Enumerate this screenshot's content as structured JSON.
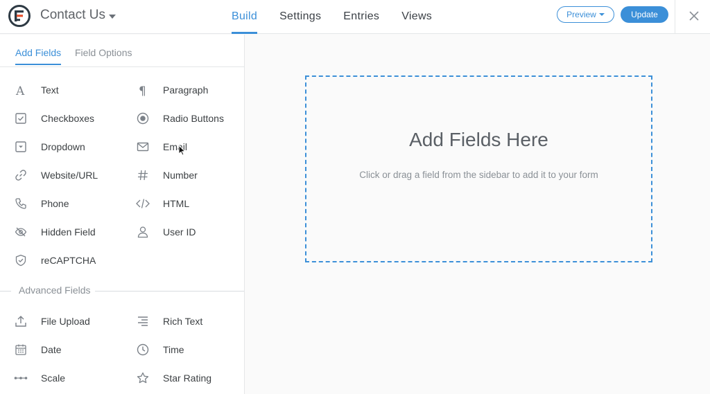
{
  "app": {
    "form_title": "Contact Us"
  },
  "nav": {
    "items": [
      {
        "label": "Build",
        "active": true
      },
      {
        "label": "Settings",
        "active": false
      },
      {
        "label": "Entries",
        "active": false
      },
      {
        "label": "Views",
        "active": false
      }
    ]
  },
  "actions": {
    "preview_label": "Preview",
    "update_label": "Update"
  },
  "sidebar": {
    "tabs": [
      {
        "label": "Add Fields",
        "active": true
      },
      {
        "label": "Field Options",
        "active": false
      }
    ],
    "fields": [
      {
        "label": "Text",
        "icon": "text-icon"
      },
      {
        "label": "Paragraph",
        "icon": "paragraph-icon"
      },
      {
        "label": "Checkboxes",
        "icon": "checkbox-icon"
      },
      {
        "label": "Radio Buttons",
        "icon": "radio-icon"
      },
      {
        "label": "Dropdown",
        "icon": "dropdown-icon"
      },
      {
        "label": "Email",
        "icon": "email-icon"
      },
      {
        "label": "Website/URL",
        "icon": "link-icon"
      },
      {
        "label": "Number",
        "icon": "hash-icon"
      },
      {
        "label": "Phone",
        "icon": "phone-icon"
      },
      {
        "label": "HTML",
        "icon": "code-icon"
      },
      {
        "label": "Hidden Field",
        "icon": "eye-off-icon"
      },
      {
        "label": "User ID",
        "icon": "user-icon"
      },
      {
        "label": "reCAPTCHA",
        "icon": "shield-icon"
      }
    ],
    "advanced_heading": "Advanced Fields",
    "advanced_fields": [
      {
        "label": "File Upload",
        "icon": "upload-icon"
      },
      {
        "label": "Rich Text",
        "icon": "rich-text-icon"
      },
      {
        "label": "Date",
        "icon": "calendar-icon"
      },
      {
        "label": "Time",
        "icon": "clock-icon"
      },
      {
        "label": "Scale",
        "icon": "scale-icon"
      },
      {
        "label": "Star Rating",
        "icon": "star-icon"
      }
    ]
  },
  "canvas": {
    "title": "Add Fields Here",
    "subtitle": "Click or drag a field from the sidebar to add it to your form"
  },
  "colors": {
    "accent": "#3b8fd8",
    "text": "#3c4043",
    "muted": "#8a9096"
  }
}
